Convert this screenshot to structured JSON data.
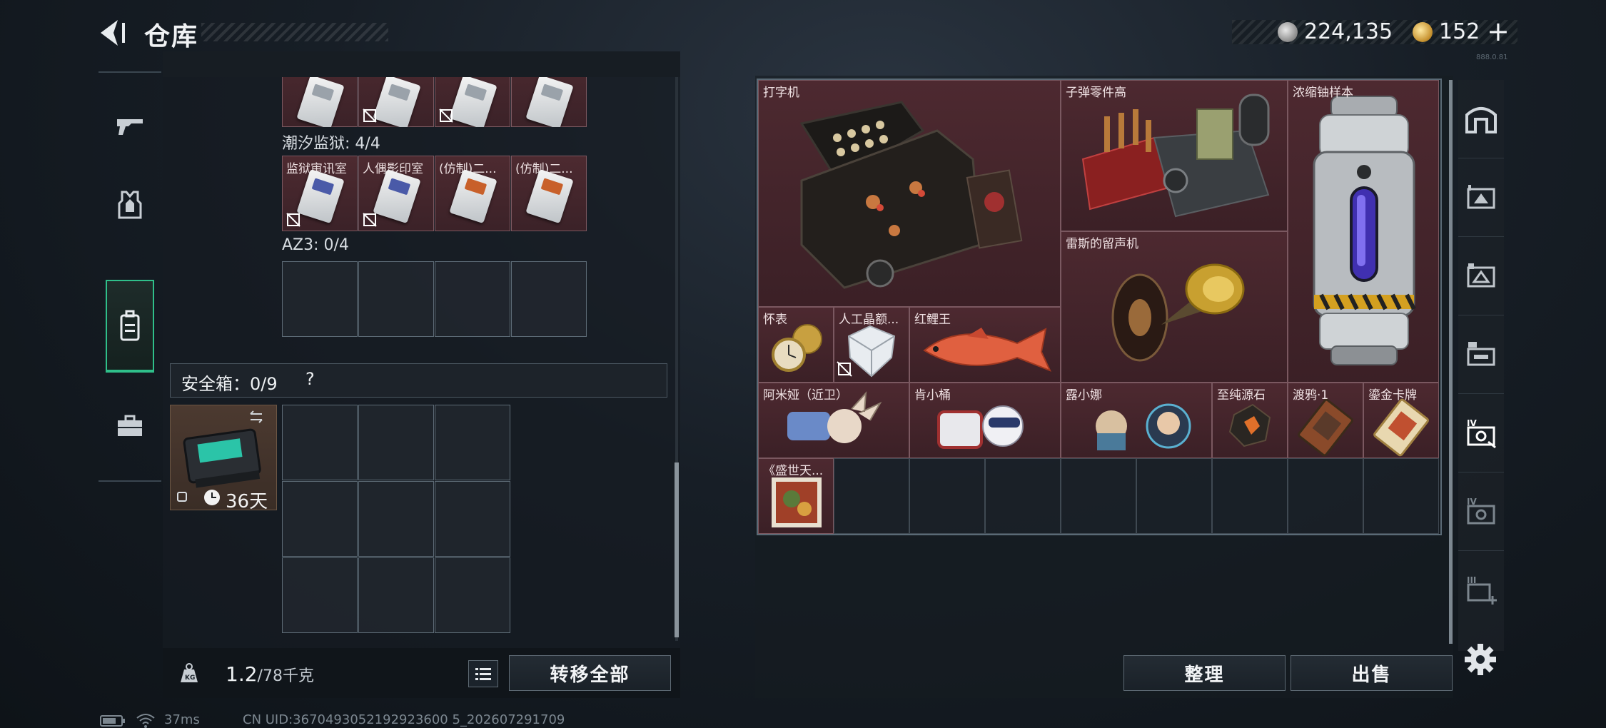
{
  "header": {
    "title": "仓库",
    "currency_silver": "224,135",
    "currency_gold": "152",
    "plus": "+",
    "tiny_id": "888.0.81"
  },
  "left_tabs": [
    "gun-icon",
    "armor-icon",
    "backpack-icon",
    "briefcase-icon"
  ],
  "left_panel": {
    "section1_label": "潮汐监狱: 4/4",
    "section1_items": [
      "监狱审讯室",
      "人偶影印室",
      "(仿制)二...",
      "(仿制)二..."
    ],
    "section2_label": "AZ3: 0/4",
    "safe_label": "安全箱：0/9",
    "safe_help": "?",
    "safe_days": "36天",
    "weight_value": "1.2",
    "weight_unit": "/78千克",
    "transfer_all": "转移全部"
  },
  "stash": {
    "items": [
      {
        "label": "打字机"
      },
      {
        "label": "子弹零件高"
      },
      {
        "label": "浓缩铀样本"
      },
      {
        "label": "雷斯的留声机"
      },
      {
        "label": "怀表"
      },
      {
        "label": "人工晶额..."
      },
      {
        "label": "红鲤王"
      },
      {
        "label": "阿米娅（近卫）"
      },
      {
        "label": "肯小桶"
      },
      {
        "label": "露小娜"
      },
      {
        "label": "至纯源石"
      },
      {
        "label": "渡鸦·1"
      },
      {
        "label": "鎏金卡牌"
      },
      {
        "label": "《盛世天..."
      }
    ],
    "sort_button": "整理",
    "sell_button": "出售"
  },
  "right_tabs": [
    "stash-home-icon",
    "stash-1-icon",
    "stash-2-icon",
    "stash-3-icon",
    "stash-4-icon",
    "stash-5-icon",
    "stash-add-icon"
  ],
  "status": {
    "ping": "37ms",
    "uid": "CN UID:3670493052192923600 5_202607291709"
  }
}
